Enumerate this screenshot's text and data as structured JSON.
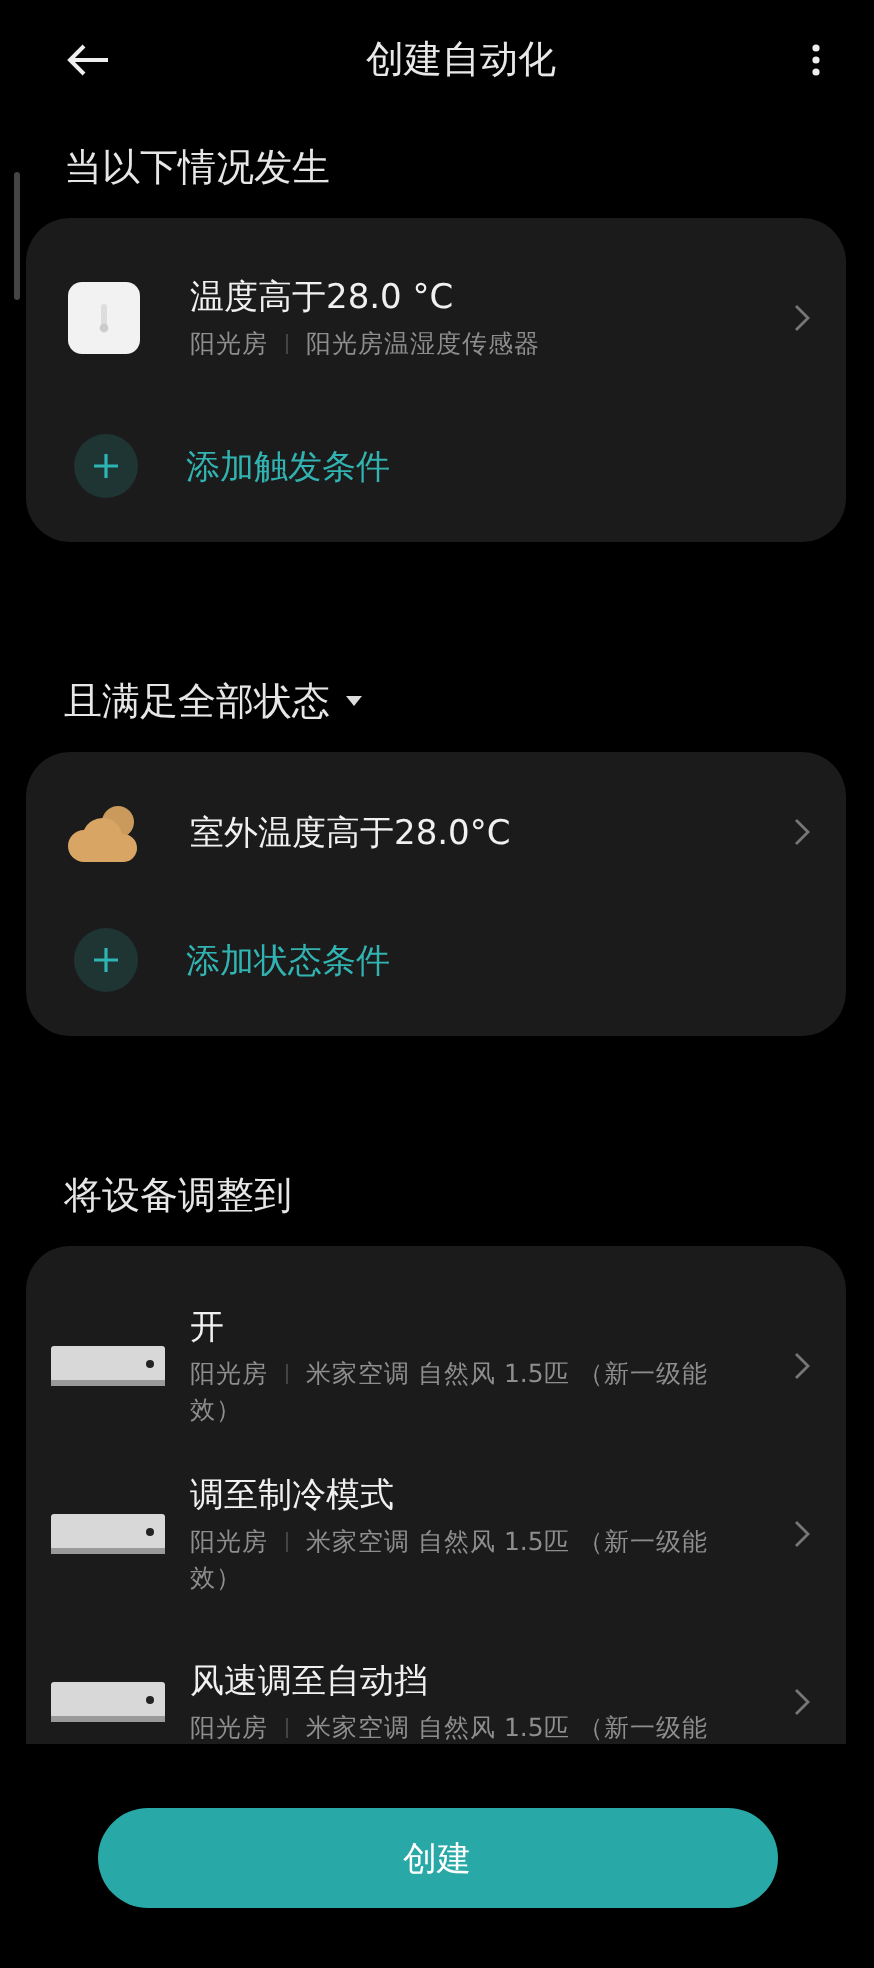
{
  "header": {
    "title": "创建自动化"
  },
  "sections": [
    {
      "title": "当以下情况发生",
      "dropdown": false,
      "add_label": "添加触发条件",
      "items": [
        {
          "kind": "sensor",
          "title": "温度高于28.0 °C",
          "room": "阳光房",
          "device": "阳光房温湿度传感器"
        }
      ]
    },
    {
      "title": "且满足全部状态",
      "dropdown": true,
      "add_label": "添加状态条件",
      "items": [
        {
          "kind": "weather",
          "title": "室外温度高于28.0°C"
        }
      ]
    },
    {
      "title": "将设备调整到",
      "dropdown": false,
      "items": [
        {
          "kind": "ac",
          "title": "开",
          "room": "阳光房",
          "device": "米家空调 自然风 1.5匹 （新一级能效）"
        },
        {
          "kind": "ac",
          "title": "调至制冷模式",
          "room": "阳光房",
          "device": "米家空调 自然风 1.5匹 （新一级能效）"
        },
        {
          "kind": "ac",
          "title": "风速调至自动挡",
          "room": "阳光房",
          "device": "米家空调 自然风 1.5匹 （新一级能"
        }
      ]
    }
  ],
  "create_button": "创建"
}
